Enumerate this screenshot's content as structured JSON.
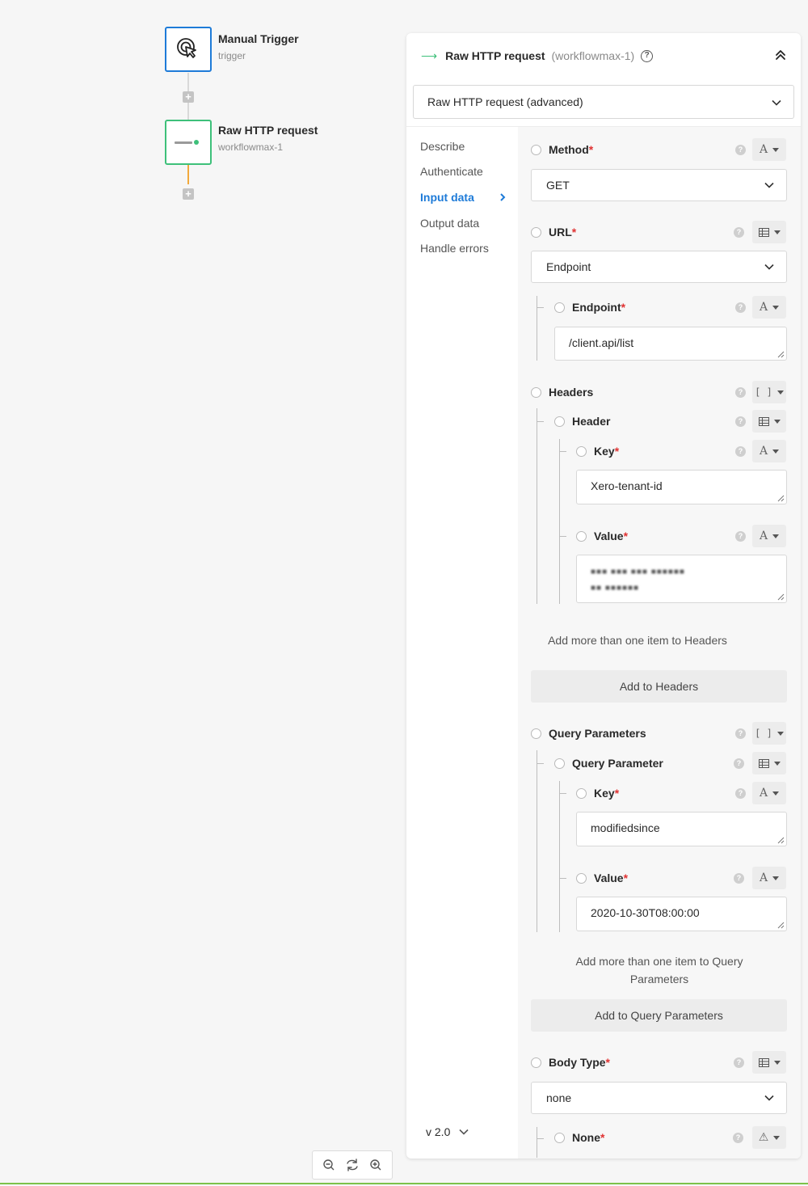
{
  "workflow": {
    "trigger_node": {
      "title": "Manual Trigger",
      "subtitle": "trigger"
    },
    "step_node": {
      "title": "Raw HTTP request",
      "subtitle": "workflowmax-1"
    }
  },
  "panel": {
    "title": "Raw HTTP request",
    "subtitle": "(workflowmax-1)",
    "help_glyph": "?",
    "operation_select": "Raw HTTP request (advanced)",
    "nav": [
      "Describe",
      "Authenticate",
      "Input data",
      "Output data",
      "Handle errors"
    ],
    "active_nav": "Input data",
    "version": "v 2.0"
  },
  "form": {
    "required_marker": "*",
    "method": {
      "label": "Method",
      "value": "GET",
      "type_glyph": "A"
    },
    "url": {
      "label": "URL",
      "value": "Endpoint"
    },
    "endpoint": {
      "label": "Endpoint",
      "value": "/client.api/list",
      "type_glyph": "A"
    },
    "headers": {
      "label": "Headers",
      "type_glyph": "[ ]",
      "item_label": "Header",
      "key": {
        "label": "Key",
        "value": "Xero-tenant-id",
        "type_glyph": "A"
      },
      "value": {
        "label": "Value",
        "line1": "■■■ ■■■ ■■■ ■■■■■■",
        "line2": "■■ ■■■■■■",
        "type_glyph": "A"
      },
      "add_more_text": "Add more than one item to Headers",
      "add_button": "Add to Headers"
    },
    "query": {
      "label": "Query Parameters",
      "type_glyph": "[ ]",
      "item_label": "Query Parameter",
      "key": {
        "label": "Key",
        "value": "modifiedsince",
        "type_glyph": "A"
      },
      "value": {
        "label": "Value",
        "value": "2020-10-30T08:00:00",
        "type_glyph": "A"
      },
      "add_more_text": "Add more than one item to Query Parameters",
      "add_button": "Add to Query Parameters"
    },
    "body_type": {
      "label": "Body Type",
      "value": "none"
    },
    "none_field": {
      "label": "None",
      "type_glyph": "⚠"
    }
  },
  "colors": {
    "accent": "#1e7bd8",
    "success": "#3ec07a",
    "required": "#e03232",
    "connector_active": "#f2a93b"
  }
}
